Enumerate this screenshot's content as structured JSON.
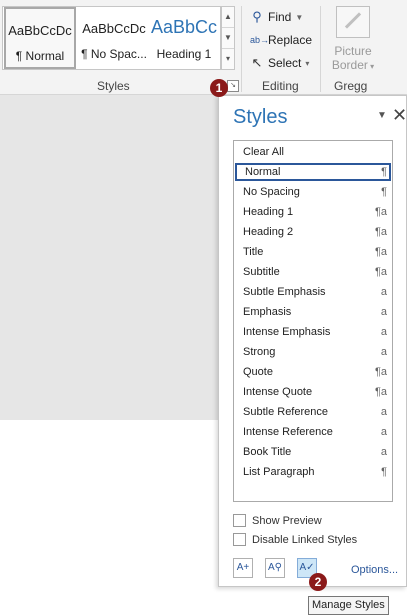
{
  "ribbon": {
    "styles_gallery": [
      {
        "preview": "AaBbCcDc",
        "name": "¶ Normal"
      },
      {
        "preview": "AaBbCcDc",
        "name": "¶ No Spac..."
      },
      {
        "preview": "AaBbCc",
        "name": "Heading 1"
      }
    ],
    "styles_group_label": "Styles",
    "editing": {
      "find": "Find",
      "replace": "Replace",
      "select": "Select",
      "group_label": "Editing"
    },
    "picture_border": {
      "line1": "Picture",
      "line2": "Border"
    },
    "gregg_group_label": "Gregg"
  },
  "markers": {
    "first": "1",
    "second": "2"
  },
  "pane": {
    "title": "Styles",
    "styles": [
      {
        "name": "Clear All",
        "mark": ""
      },
      {
        "name": "Normal",
        "mark": "¶"
      },
      {
        "name": "No Spacing",
        "mark": "¶"
      },
      {
        "name": "Heading 1",
        "mark": "¶a"
      },
      {
        "name": "Heading 2",
        "mark": "¶a"
      },
      {
        "name": "Title",
        "mark": "¶a"
      },
      {
        "name": "Subtitle",
        "mark": "¶a"
      },
      {
        "name": "Subtle Emphasis",
        "mark": "a"
      },
      {
        "name": "Emphasis",
        "mark": "a"
      },
      {
        "name": "Intense Emphasis",
        "mark": "a"
      },
      {
        "name": "Strong",
        "mark": "a"
      },
      {
        "name": "Quote",
        "mark": "¶a"
      },
      {
        "name": "Intense Quote",
        "mark": "¶a"
      },
      {
        "name": "Subtle Reference",
        "mark": "a"
      },
      {
        "name": "Intense Reference",
        "mark": "a"
      },
      {
        "name": "Book Title",
        "mark": "a"
      },
      {
        "name": "List Paragraph",
        "mark": "¶"
      }
    ],
    "show_preview": "Show Preview",
    "disable_linked": "Disable Linked Styles",
    "options": "Options..."
  },
  "tooltip": "Manage Styles",
  "colors": {
    "accent": "#2e74b5",
    "marker": "#8b1a1a"
  }
}
